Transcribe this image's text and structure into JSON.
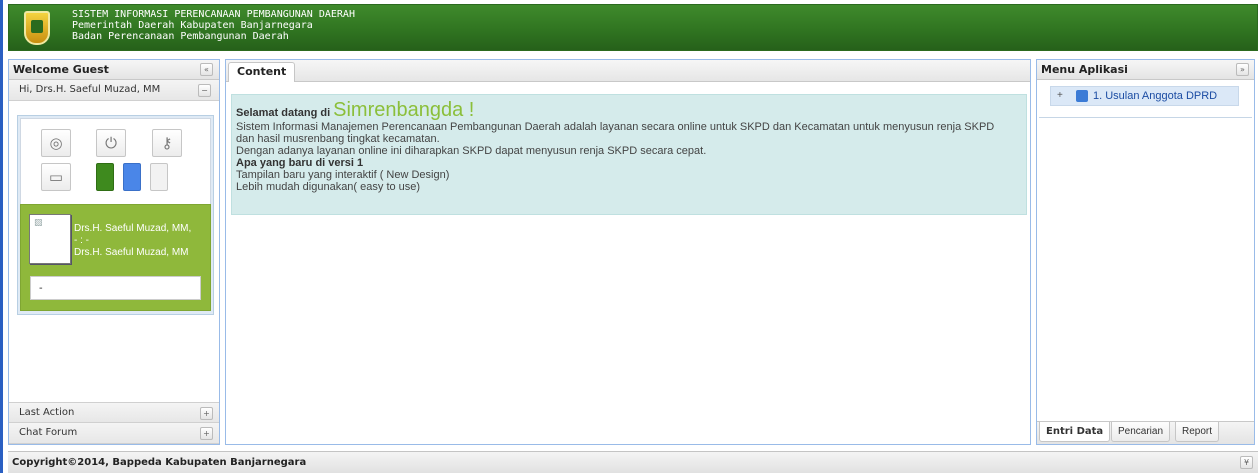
{
  "header": {
    "line1": "SISTEM INFORMASI PERENCANAAN PEMBANGUNAN DAERAH",
    "line2": "Pemerintah Daerah Kabupaten Banjarnegara",
    "line3": "Badan Perencanaan Pembangunan Daerah"
  },
  "left": {
    "title": "Welcome Guest",
    "collapse_icon": "«",
    "user_header": "Hi, Drs.H. Saeful Muzad, MM",
    "user_toggle": "−",
    "icons": [
      "dashboard-icon",
      "power-icon",
      "key-icon",
      "folder-icon",
      "green-swatch",
      "blue-swatch",
      "grey-swatch"
    ],
    "name_line1": "Drs.H. Saeful Muzad, MM,",
    "name_line2": "- : -",
    "name_line3": "Drs.H. Saeful Muzad, MM",
    "info": "-",
    "last_action": "Last Action",
    "chat_forum": "Chat Forum",
    "plus": "+"
  },
  "center": {
    "tab": "Content",
    "greet_small": "Selamat datang di",
    "greet_big": "Simrenbangda !",
    "p1": "Sistem Informasi Manajemen Perencanaan Pembangunan Daerah adalah layanan secara online untuk SKPD dan Kecamatan untuk menyusun renja SKPD",
    "p2": "dan hasil musrenbang tingkat kecamatan.",
    "p3": "Dengan adanya layanan online ini diharapkan SKPD dapat menyusun renja SKPD secara cepat.",
    "p4": "Apa yang baru di versi 1",
    "p5": "Tampilan baru yang interaktif ( New Design)",
    "p6": "Lebih mudah digunakan( easy to use)"
  },
  "right": {
    "title": "Menu Aplikasi",
    "expand_icon": "»",
    "tree_plus": "+",
    "tree_item": "1. Usulan Anggota DPRD",
    "tabs": [
      "Entri Data",
      "Pencarian",
      "Report"
    ]
  },
  "footer": {
    "text": "Copyright©2014, Bappeda Kabupaten Banjarnegara",
    "toggle": "¥"
  },
  "colors": {
    "header_green": "#2f7320",
    "accent_green": "#8bbf3a",
    "panel_border": "#99bbe8",
    "welcome_bg": "#d5ebeb"
  }
}
